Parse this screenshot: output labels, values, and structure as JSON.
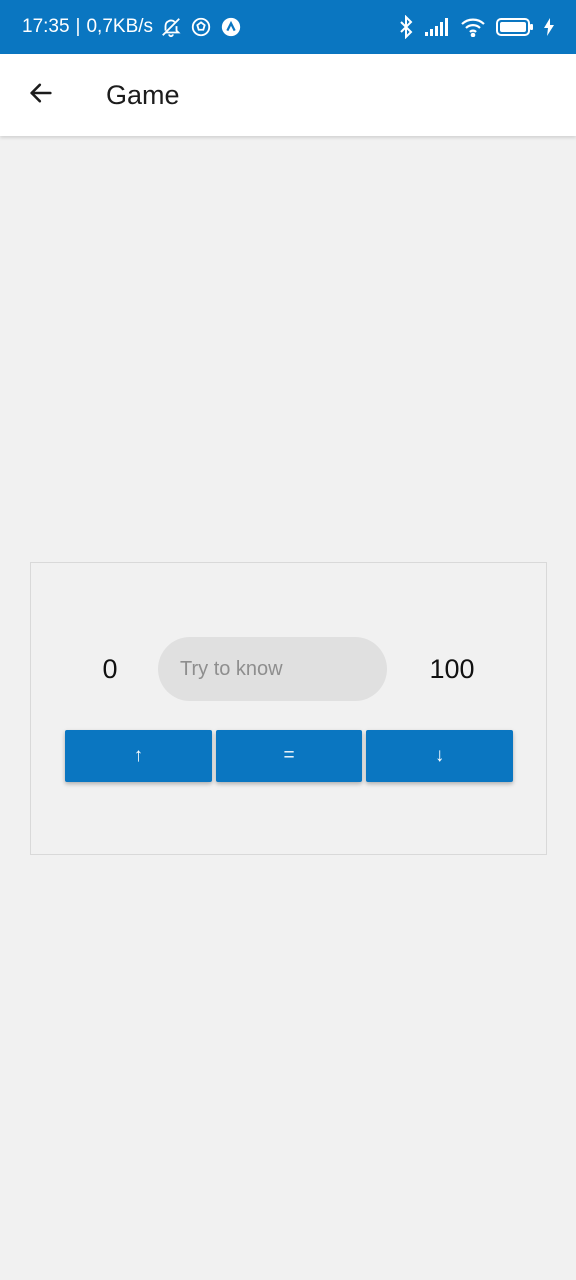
{
  "status_bar": {
    "time": "17:35",
    "separator": "|",
    "network_speed": "0,7KB/s",
    "left_icons": [
      "mute-alarm-icon",
      "soccer-ball-icon",
      "arrow-app-icon"
    ],
    "right_icons": [
      "bluetooth-icon",
      "signal-icon",
      "wifi-icon",
      "battery-icon",
      "charging-icon"
    ],
    "background_color": "#0a76c1"
  },
  "app_bar": {
    "title": "Game",
    "back_icon": "arrow-left-icon"
  },
  "game": {
    "min_value": "0",
    "max_value": "100",
    "input": {
      "value": "",
      "placeholder": "Try to know"
    },
    "buttons": {
      "higher_label": "↑",
      "equal_label": "=",
      "lower_label": "↓"
    },
    "accent_color": "#0a76c1"
  }
}
